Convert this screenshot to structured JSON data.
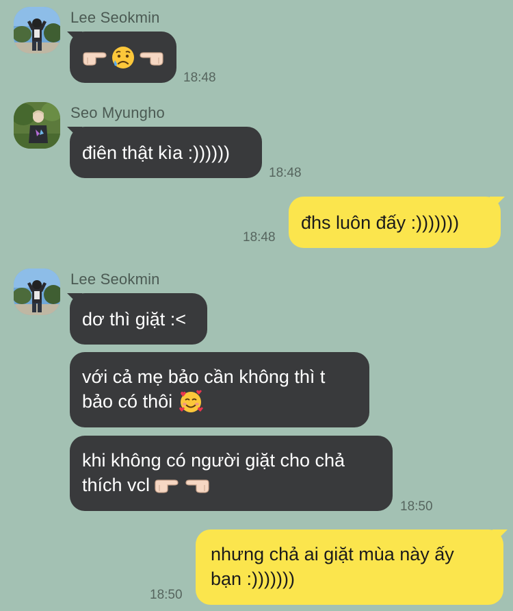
{
  "messages": [
    {
      "sender": "Lee Seokmin",
      "avatar": "avatar-lee-seokmin",
      "lines": [
        ""
      ],
      "emoji": [
        "pointing-right-hand-icon",
        "sad-sweat-face-icon",
        "pointing-left-hand-icon"
      ],
      "time": "18:48"
    },
    {
      "sender": "Seo Myungho",
      "avatar": "avatar-seo-myungho",
      "text": "điên thật kìa :))))))",
      "time": "18:48"
    },
    {
      "sender": "me",
      "text": "đhs luôn đấy :)))))))",
      "time": "18:48"
    },
    {
      "sender": "Lee Seokmin",
      "avatar": "avatar-lee-seokmin",
      "text": "dơ thì giặt :<"
    },
    {
      "sender": "Lee Seokmin",
      "line1": "với cả mẹ bảo cần không thì t",
      "line2": "bảo có thôi",
      "emoji": [
        "smiling-face-with-hearts-icon"
      ]
    },
    {
      "sender": "Lee Seokmin",
      "line1": "khi không có người giặt cho chả",
      "line2": "thích vcl",
      "emoji": [
        "pointing-right-hand-icon",
        "pointing-left-hand-icon"
      ],
      "time": "18:50"
    },
    {
      "sender": "me",
      "line1": "nhưng chả ai giặt mùa này ấy",
      "line2": "bạn :)))))))",
      "time": "18:50"
    }
  ],
  "colors": {
    "background": "#a3c1b3",
    "incoming_bubble": "#393a3c",
    "outgoing_bubble": "#fbe54d"
  }
}
